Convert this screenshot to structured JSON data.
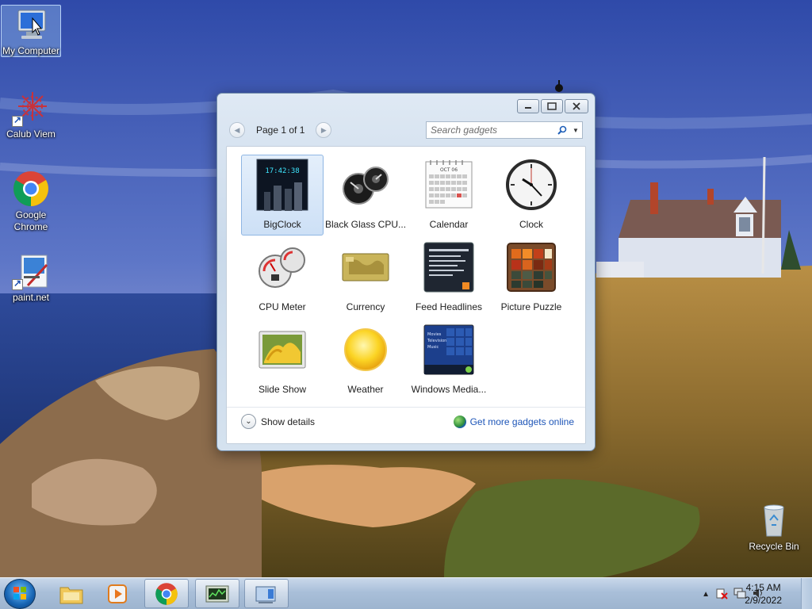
{
  "desktop": {
    "icons": [
      {
        "label": "My Computer"
      },
      {
        "label": "Calub Viem"
      },
      {
        "label": "Google Chrome"
      },
      {
        "label": "paint.net"
      },
      {
        "label": "Recycle Bin"
      }
    ]
  },
  "gallery": {
    "page_label": "Page 1 of 1",
    "search_placeholder": "Search gadgets",
    "gadgets": [
      {
        "label": "BigClock",
        "icon": "bigclock-icon",
        "selected": true
      },
      {
        "label": "Black Glass CPU...",
        "icon": "black-glass-cpu-icon"
      },
      {
        "label": "Calendar",
        "icon": "calendar-icon"
      },
      {
        "label": "Clock",
        "icon": "clock-icon"
      },
      {
        "label": "CPU Meter",
        "icon": "cpu-meter-icon"
      },
      {
        "label": "Currency",
        "icon": "currency-icon"
      },
      {
        "label": "Feed Headlines",
        "icon": "feed-headlines-icon"
      },
      {
        "label": "Picture Puzzle",
        "icon": "picture-puzzle-icon"
      },
      {
        "label": "Slide Show",
        "icon": "slide-show-icon"
      },
      {
        "label": "Weather",
        "icon": "weather-icon"
      },
      {
        "label": "Windows Media...",
        "icon": "windows-media-center-icon"
      }
    ],
    "bigclock_time": "17:42:38",
    "calendar_month": "OCT 06",
    "media_lines": [
      "Movies",
      "Television",
      "Music"
    ],
    "show_details_label": "Show details",
    "more_online_label": "Get more gadgets online"
  },
  "taskbar": {
    "time": "4:15 AM",
    "date": "2/9/2022"
  },
  "colors": {
    "link": "#1e56b8",
    "selection": "#cde0f6",
    "taskbar": "#a9bfd9"
  }
}
